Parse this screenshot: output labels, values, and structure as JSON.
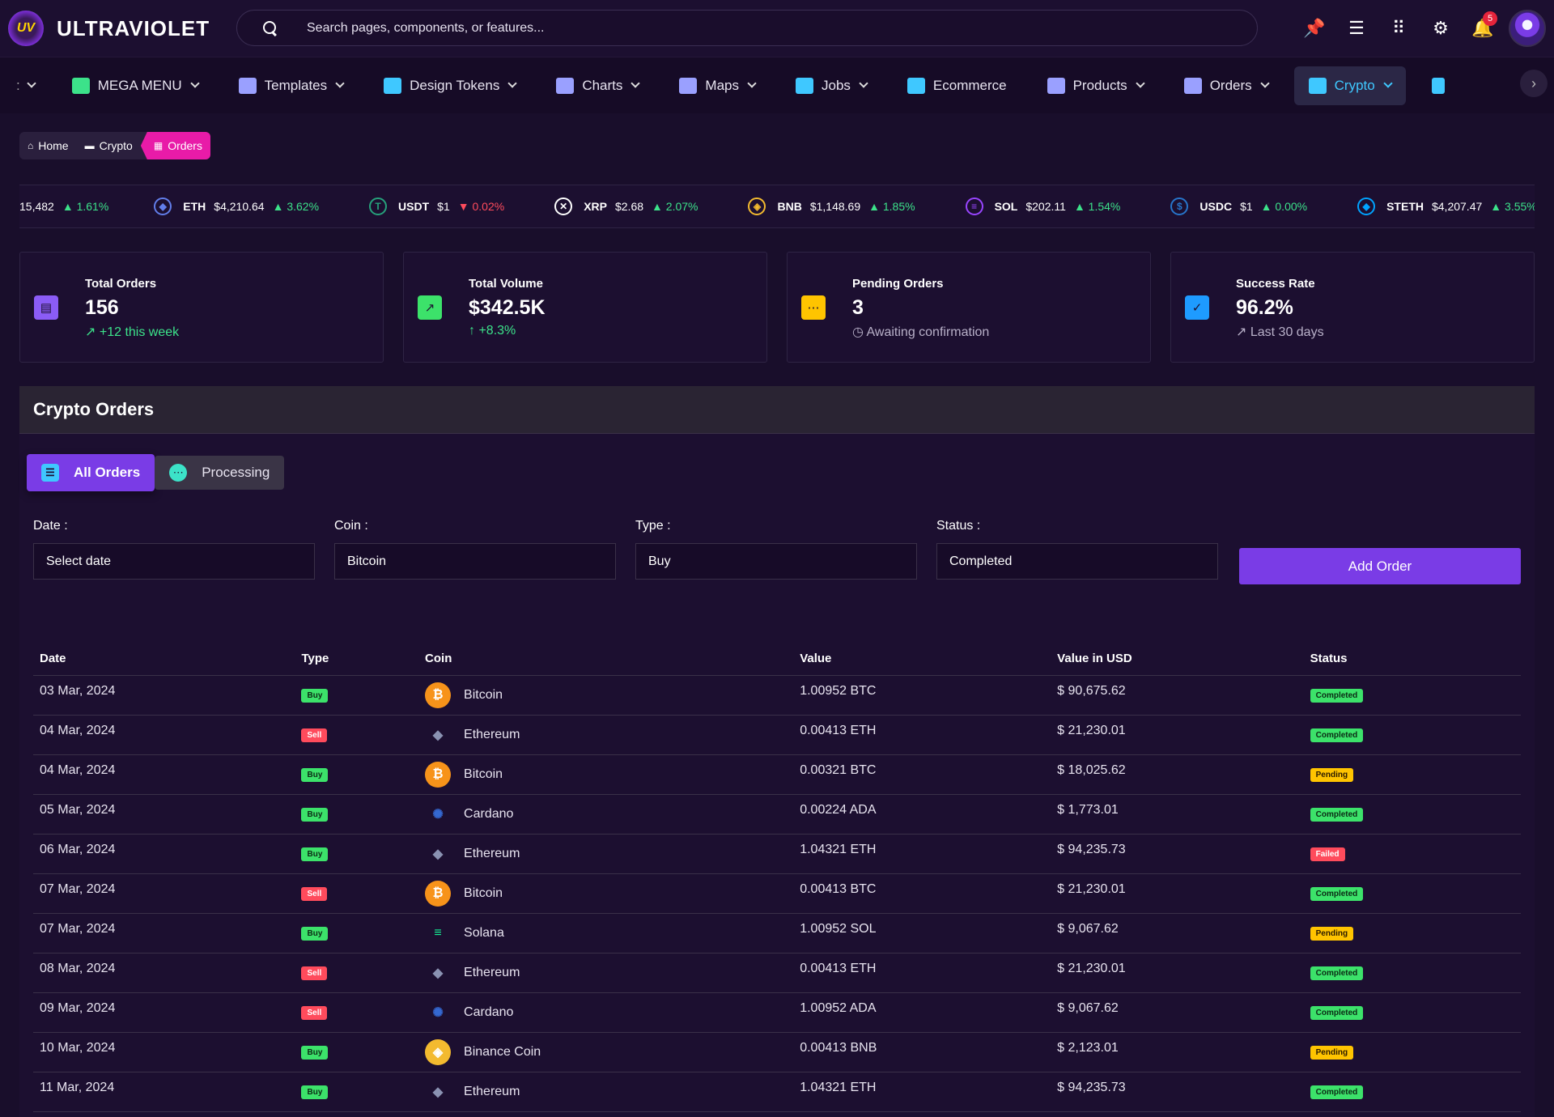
{
  "app": {
    "name": "ULTRAVIOLET",
    "logo_text": "UV"
  },
  "search": {
    "placeholder": "Search pages, components, or features..."
  },
  "topbar": {
    "notifications_count": "5"
  },
  "nav": [
    {
      "label": "MEGA MENU",
      "icon": "grid-icon",
      "color": "#3ce28a"
    },
    {
      "label": "Templates",
      "icon": "dots-grid-icon",
      "color": "#9aa0ff"
    },
    {
      "label": "Design Tokens",
      "icon": "brush-icon",
      "color": "#3fc8ff"
    },
    {
      "label": "Charts",
      "icon": "bar-chart-icon",
      "color": "#9aa0ff"
    },
    {
      "label": "Maps",
      "icon": "map-icon",
      "color": "#9aa0ff"
    },
    {
      "label": "Jobs",
      "icon": "briefcase-icon",
      "color": "#3fc8ff"
    },
    {
      "label": "Ecommerce",
      "icon": "store-icon",
      "color": "#3fc8ff"
    },
    {
      "label": "Products",
      "icon": "clipboard-icon",
      "color": "#9aa0ff"
    },
    {
      "label": "Orders",
      "icon": "receipt-icon",
      "color": "#9aa0ff"
    },
    {
      "label": "Crypto",
      "icon": "wallet-icon",
      "color": "#3fc8ff",
      "active": true
    }
  ],
  "breadcrumb": [
    {
      "label": "Home",
      "icon": "home-icon"
    },
    {
      "label": "Crypto",
      "icon": "folder-icon"
    },
    {
      "label": "Orders",
      "icon": "grid-icon"
    }
  ],
  "ticker": [
    {
      "symbol": "",
      "price": "15,482",
      "change": "▲ 1.61%",
      "dir": "up",
      "color": "#f7931a",
      "glyph": ""
    },
    {
      "symbol": "ETH",
      "price": "$4,210.64",
      "change": "▲ 3.62%",
      "dir": "up",
      "color": "#627eea",
      "glyph": "◆"
    },
    {
      "symbol": "USDT",
      "price": "$1",
      "change": "▼ 0.02%",
      "dir": "dn",
      "color": "#26a17b",
      "glyph": "T"
    },
    {
      "symbol": "XRP",
      "price": "$2.68",
      "change": "▲ 2.07%",
      "dir": "up",
      "color": "#ffffff",
      "glyph": "✕"
    },
    {
      "symbol": "BNB",
      "price": "$1,148.69",
      "change": "▲ 1.85%",
      "dir": "up",
      "color": "#f3ba2f",
      "glyph": "◈"
    },
    {
      "symbol": "SOL",
      "price": "$202.11",
      "change": "▲ 1.54%",
      "dir": "up",
      "color": "#9945ff",
      "glyph": "≡"
    },
    {
      "symbol": "USDC",
      "price": "$1",
      "change": "▲ 0.00%",
      "dir": "up",
      "color": "#2775ca",
      "glyph": "$"
    },
    {
      "symbol": "STETH",
      "price": "$4,207.47",
      "change": "▲ 3.55%",
      "dir": "up",
      "color": "#00a3ff",
      "glyph": "◆"
    }
  ],
  "stats": [
    {
      "label": "Total Orders",
      "value": "156",
      "sub": "↗ +12 this week",
      "sub_color": "#3ce28a",
      "icon": "receipt-icon",
      "color": "#8b5cf6",
      "glyph": "▤"
    },
    {
      "label": "Total Volume",
      "value": "$342.5K",
      "sub": "↑ +8.3%",
      "sub_color": "#3ce28a",
      "icon": "trending-up-icon",
      "color": "#3ce26a",
      "glyph": "↗"
    },
    {
      "label": "Pending Orders",
      "value": "3",
      "sub": "◷ Awaiting confirmation",
      "sub_color": "#b8b0c8",
      "icon": "pending-icon",
      "color": "#ffc400",
      "glyph": "⋯"
    },
    {
      "label": "Success Rate",
      "value": "96.2%",
      "sub": "↗ Last 30 days",
      "sub_color": "#b8b0c8",
      "icon": "check-badge-icon",
      "color": "#1e9bff",
      "glyph": "✓"
    }
  ],
  "panel": {
    "title": "Crypto Orders"
  },
  "tabs": [
    {
      "label": "All Orders",
      "active": true
    },
    {
      "label": "Processing",
      "active": false
    }
  ],
  "filters": {
    "date": {
      "label": "Date :",
      "value": "Select date"
    },
    "coin": {
      "label": "Coin :",
      "value": "Bitcoin"
    },
    "type": {
      "label": "Type :",
      "value": "Buy"
    },
    "status": {
      "label": "Status :",
      "value": "Completed"
    },
    "add_button": "Add Order"
  },
  "table": {
    "columns": [
      "Date",
      "Type",
      "Coin",
      "Value",
      "Value in USD",
      "Status"
    ],
    "rows": [
      {
        "date": "03 Mar, 2024",
        "type": "Buy",
        "coin": "Bitcoin",
        "value": "1.00952 BTC",
        "usd": "$ 90,675.62",
        "status": "Completed"
      },
      {
        "date": "04 Mar, 2024",
        "type": "Sell",
        "coin": "Ethereum",
        "value": "0.00413 ETH",
        "usd": "$ 21,230.01",
        "status": "Completed"
      },
      {
        "date": "04 Mar, 2024",
        "type": "Buy",
        "coin": "Bitcoin",
        "value": "0.00321 BTC",
        "usd": "$ 18,025.62",
        "status": "Pending"
      },
      {
        "date": "05 Mar, 2024",
        "type": "Buy",
        "coin": "Cardano",
        "value": "0.00224 ADA",
        "usd": "$ 1,773.01",
        "status": "Completed"
      },
      {
        "date": "06 Mar, 2024",
        "type": "Buy",
        "coin": "Ethereum",
        "value": "1.04321 ETH",
        "usd": "$ 94,235.73",
        "status": "Failed"
      },
      {
        "date": "07 Mar, 2024",
        "type": "Sell",
        "coin": "Bitcoin",
        "value": "0.00413 BTC",
        "usd": "$ 21,230.01",
        "status": "Completed"
      },
      {
        "date": "07 Mar, 2024",
        "type": "Buy",
        "coin": "Solana",
        "value": "1.00952 SOL",
        "usd": "$ 9,067.62",
        "status": "Pending"
      },
      {
        "date": "08 Mar, 2024",
        "type": "Sell",
        "coin": "Ethereum",
        "value": "0.00413 ETH",
        "usd": "$ 21,230.01",
        "status": "Completed"
      },
      {
        "date": "09 Mar, 2024",
        "type": "Sell",
        "coin": "Cardano",
        "value": "1.00952 ADA",
        "usd": "$ 9,067.62",
        "status": "Completed"
      },
      {
        "date": "10 Mar, 2024",
        "type": "Buy",
        "coin": "Binance Coin",
        "value": "0.00413 BNB",
        "usd": "$ 2,123.01",
        "status": "Pending"
      },
      {
        "date": "11 Mar, 2024",
        "type": "Buy",
        "coin": "Ethereum",
        "value": "1.04321 ETH",
        "usd": "$ 94,235.73",
        "status": "Completed"
      }
    ]
  },
  "coin_styles": {
    "Bitcoin": {
      "bg": "#f7931a",
      "fg": "#ffffff",
      "glyph": "₿"
    },
    "Ethereum": {
      "bg": "transparent",
      "fg": "#8a92b2",
      "glyph": "◆"
    },
    "Cardano": {
      "bg": "transparent",
      "fg": "#3468d1",
      "glyph": "✺"
    },
    "Solana": {
      "bg": "transparent",
      "fg": "#14f195",
      "glyph": "≡"
    },
    "Binance Coin": {
      "bg": "#f3ba2f",
      "fg": "#ffffff",
      "glyph": "◈"
    }
  }
}
